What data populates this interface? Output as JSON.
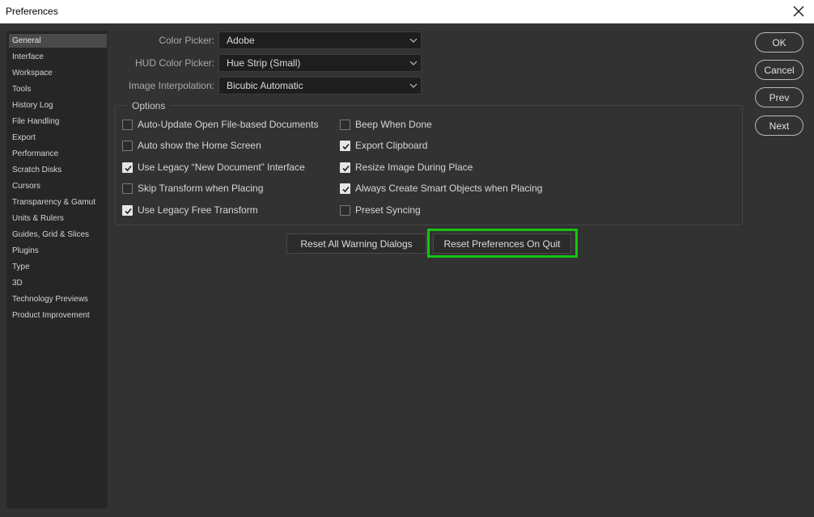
{
  "window": {
    "title": "Preferences"
  },
  "sidebar": {
    "items": [
      {
        "label": "General",
        "selected": true
      },
      {
        "label": "Interface"
      },
      {
        "label": "Workspace"
      },
      {
        "label": "Tools"
      },
      {
        "label": "History Log"
      },
      {
        "label": "File Handling"
      },
      {
        "label": "Export"
      },
      {
        "label": "Performance"
      },
      {
        "label": "Scratch Disks"
      },
      {
        "label": "Cursors"
      },
      {
        "label": "Transparency & Gamut"
      },
      {
        "label": "Units & Rulers"
      },
      {
        "label": "Guides, Grid & Slices"
      },
      {
        "label": "Plugins"
      },
      {
        "label": "Type"
      },
      {
        "label": "3D"
      },
      {
        "label": "Technology Previews"
      },
      {
        "label": "Product Improvement"
      }
    ]
  },
  "general": {
    "color_picker": {
      "label": "Color Picker:",
      "value": "Adobe"
    },
    "hud_color_picker": {
      "label": "HUD Color Picker:",
      "value": "Hue Strip (Small)"
    },
    "image_interpolation": {
      "label": "Image Interpolation:",
      "value": "Bicubic Automatic"
    },
    "options_legend": "Options",
    "options": [
      {
        "label": "Auto-Update Open File-based Documents",
        "checked": false
      },
      {
        "label": "Auto show the Home Screen",
        "checked": false
      },
      {
        "label": "Use Legacy “New Document” Interface",
        "checked": true
      },
      {
        "label": "Skip Transform when Placing",
        "checked": false
      },
      {
        "label": "Use Legacy Free Transform",
        "checked": true
      },
      {
        "label": "Beep When Done",
        "checked": false
      },
      {
        "label": "Export Clipboard",
        "checked": true
      },
      {
        "label": "Resize Image During Place",
        "checked": true
      },
      {
        "label": "Always Create Smart Objects when Placing",
        "checked": true
      },
      {
        "label": "Preset Syncing",
        "checked": false
      }
    ],
    "reset_warnings_label": "Reset All Warning Dialogs",
    "reset_prefs_label": "Reset Preferences On Quit"
  },
  "actions": {
    "ok": "OK",
    "cancel": "Cancel",
    "prev": "Prev",
    "next": "Next"
  },
  "colors": {
    "background": "#323232",
    "sidebar_bg": "#262626",
    "selected_item": "#4a4a4a",
    "highlight": "#14c414"
  }
}
